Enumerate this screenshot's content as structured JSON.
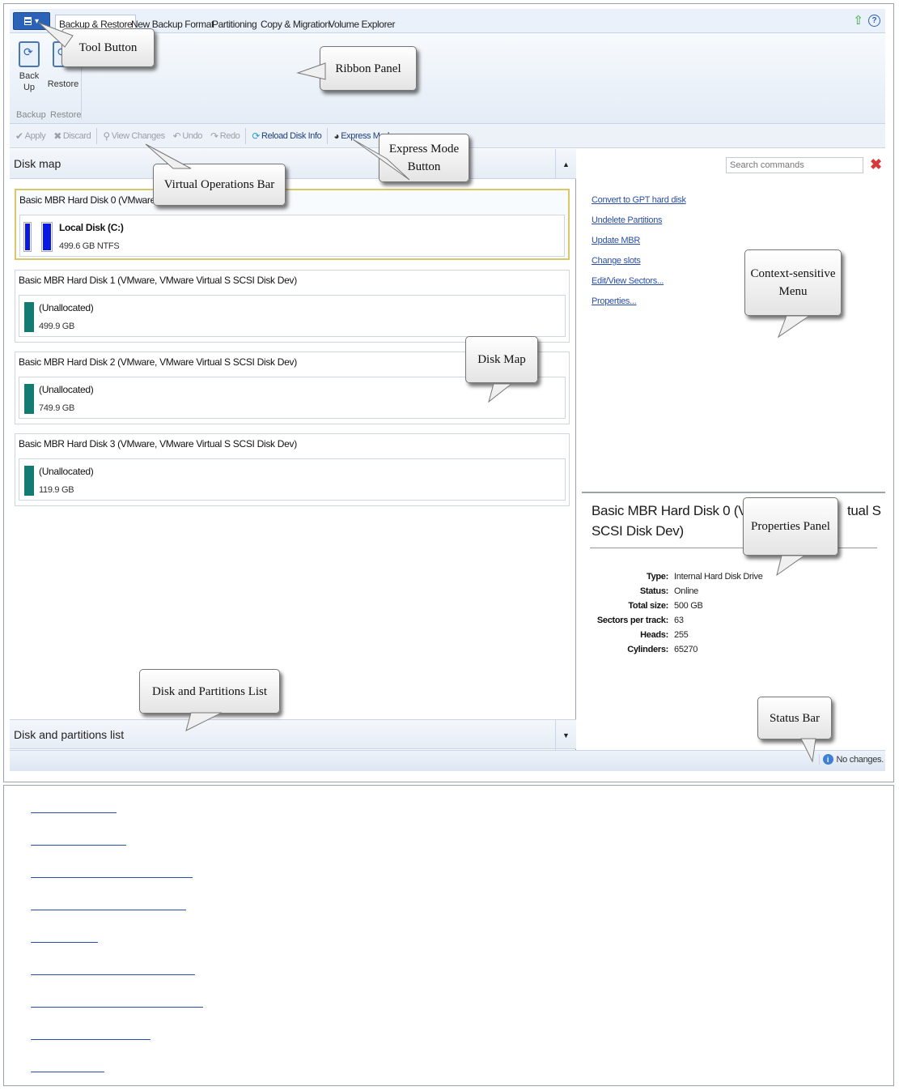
{
  "toolbar": {
    "tool_button_label": "▾"
  },
  "tabs": [
    "Backup & Restore",
    "New Backup Format",
    "Partitioning",
    "Copy & Migration",
    "Volume Explorer"
  ],
  "ribbon": {
    "buttons": [
      {
        "label1": "Back",
        "label2": "Up"
      },
      {
        "label1": "Restore",
        "label2": ""
      }
    ],
    "groups": [
      "Backup",
      "Restore"
    ]
  },
  "virtual_ops": {
    "apply": "Apply",
    "discard": "Discard",
    "view_changes": "View Changes",
    "undo": "Undo",
    "redo": "Redo",
    "reload": "Reload Disk Info",
    "express": "Express Mode"
  },
  "disk_map": {
    "header": "Disk map",
    "disks": [
      {
        "title": "Basic MBR Hard Disk 0 (VMware,",
        "part_label": "Local Disk (C:)",
        "part_size": "499.6 GB NTFS"
      },
      {
        "title": "Basic MBR Hard Disk 1 (VMware, VMware Virtual S SCSI Disk Dev)",
        "part_label": "(Unallocated)",
        "part_size": "499.9 GB"
      },
      {
        "title": "Basic MBR Hard Disk 2 (VMware, VMware Virtual S SCSI Disk Dev)",
        "part_label": "(Unallocated)",
        "part_size": "749.9 GB"
      },
      {
        "title": "Basic MBR Hard Disk 3 (VMware, VMware Virtual S SCSI Disk Dev)",
        "part_label": "(Unallocated)",
        "part_size": "119.9 GB"
      }
    ]
  },
  "partitions_list_header": "Disk and partitions list",
  "context_menu": {
    "search_placeholder": "Search commands",
    "items": [
      "Convert to GPT hard disk",
      "Undelete Partitions",
      "Update MBR",
      "Change slots",
      "Edit/View Sectors...",
      "Properties..."
    ]
  },
  "properties": {
    "title_a": "Basic MBR Hard Disk 0 (VM",
    "title_b": "tual S",
    "title_c": "SCSI Disk Dev)",
    "rows": [
      {
        "key": "Type:",
        "value": "Internal Hard Disk Drive"
      },
      {
        "key": "Status:",
        "value": "Online"
      },
      {
        "key": "Total size:",
        "value": "500 GB"
      },
      {
        "key": "Sectors per track:",
        "value": "63"
      },
      {
        "key": "Heads:",
        "value": "255"
      },
      {
        "key": "Cylinders:",
        "value": "65270"
      }
    ]
  },
  "status_bar": {
    "text": "No changes."
  },
  "callouts": {
    "tool_button": "Tool Button",
    "ribbon_panel": "Ribbon Panel",
    "express_mode_1": "Express Mode",
    "express_mode_2": "Button",
    "virtual_ops_bar": "Virtual Operations Bar",
    "context_menu_1": "Context-sensitive",
    "context_menu_2": "Menu",
    "disk_map": "Disk Map",
    "properties_panel": "Properties Panel",
    "disk_partitions_list": "Disk and Partitions List",
    "status_bar": "Status Bar"
  },
  "colors": {
    "accent": "#2a62b8",
    "primary_partition": "#0a18e6",
    "unallocated": "#127c72",
    "link": "#2a4ea8",
    "selection_border": "#d9c86a"
  }
}
